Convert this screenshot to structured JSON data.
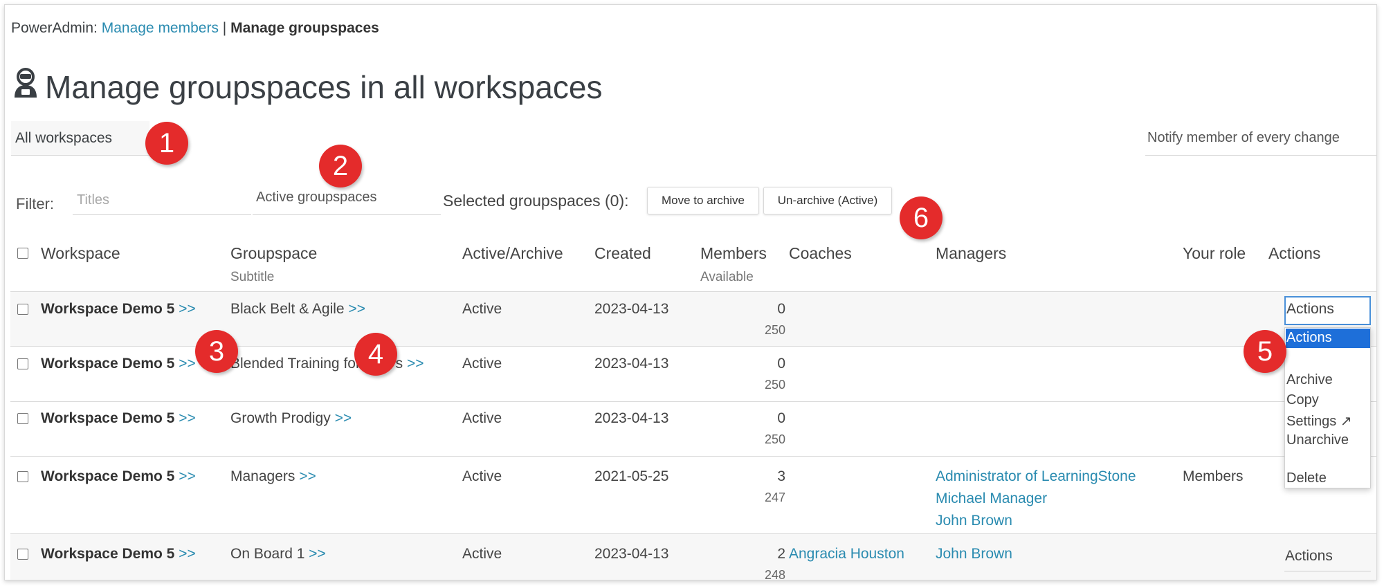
{
  "breadcrumb": {
    "prefix": "PowerAdmin: ",
    "link": "Manage members",
    "sep": " | ",
    "current": "Manage groupspaces"
  },
  "page_title": "Manage groupspaces in all workspaces",
  "workspace_select": {
    "value": "All workspaces"
  },
  "notify_select": {
    "value": "Notify member of every change"
  },
  "filter": {
    "label": "Filter:",
    "titles_placeholder": "Titles",
    "status_value": "Active groupspaces"
  },
  "selection": {
    "label": "Selected groupspaces (0):",
    "move_to_archive": "Move to archive",
    "unarchive": "Un-archive (Active)"
  },
  "callouts": [
    "1",
    "2",
    "3",
    "4",
    "5",
    "6"
  ],
  "columns": {
    "workspace": "Workspace",
    "groupspace": "Groupspace",
    "groupspace_sub": "Subtitle",
    "active_archive": "Active/Archive",
    "created": "Created",
    "members": "Members",
    "members_sub": "Available",
    "coaches": "Coaches",
    "managers": "Managers",
    "your_role": "Your role",
    "actions": "Actions"
  },
  "link_suffix": ">>",
  "rows": [
    {
      "workspace": "Workspace Demo 5",
      "groupspace": "Black Belt & Agile",
      "status": "Active",
      "created": "2023-04-13",
      "members": "0",
      "available": "250",
      "coaches": [],
      "managers": [],
      "role": ""
    },
    {
      "workspace": "Workspace Demo 5",
      "groupspace": "Blended Training for L&D's",
      "status": "Active",
      "created": "2023-04-13",
      "members": "0",
      "available": "250",
      "coaches": [],
      "managers": [],
      "role": ""
    },
    {
      "workspace": "Workspace Demo 5",
      "groupspace": "Growth Prodigy",
      "status": "Active",
      "created": "2023-04-13",
      "members": "0",
      "available": "250",
      "coaches": [],
      "managers": [],
      "role": ""
    },
    {
      "workspace": "Workspace Demo 5",
      "groupspace": "Managers",
      "status": "Active",
      "created": "2021-05-25",
      "members": "3",
      "available": "247",
      "coaches": [],
      "managers": [
        "Administrator of LearningStone",
        "Michael Manager",
        "John Brown"
      ],
      "role": "Members"
    },
    {
      "workspace": "Workspace Demo 5",
      "groupspace": "On Board 1",
      "status": "Active",
      "created": "2023-04-13",
      "members": "2",
      "available": "248",
      "coaches": [
        "Angracia Houston"
      ],
      "managers": [
        "John Brown"
      ],
      "role": ""
    }
  ],
  "actions_select": {
    "value": "Actions"
  },
  "actions_dropdown": [
    "Actions",
    "Archive",
    "Copy",
    "Settings ↗",
    "Unarchive",
    "Delete"
  ],
  "actions_last": "Actions",
  "colors": {
    "link": "#2a8bb0",
    "badge": "#e42b2b",
    "dropdown_selected": "#1e6fd9"
  },
  "icons": {
    "title": "robot-admin-icon"
  }
}
